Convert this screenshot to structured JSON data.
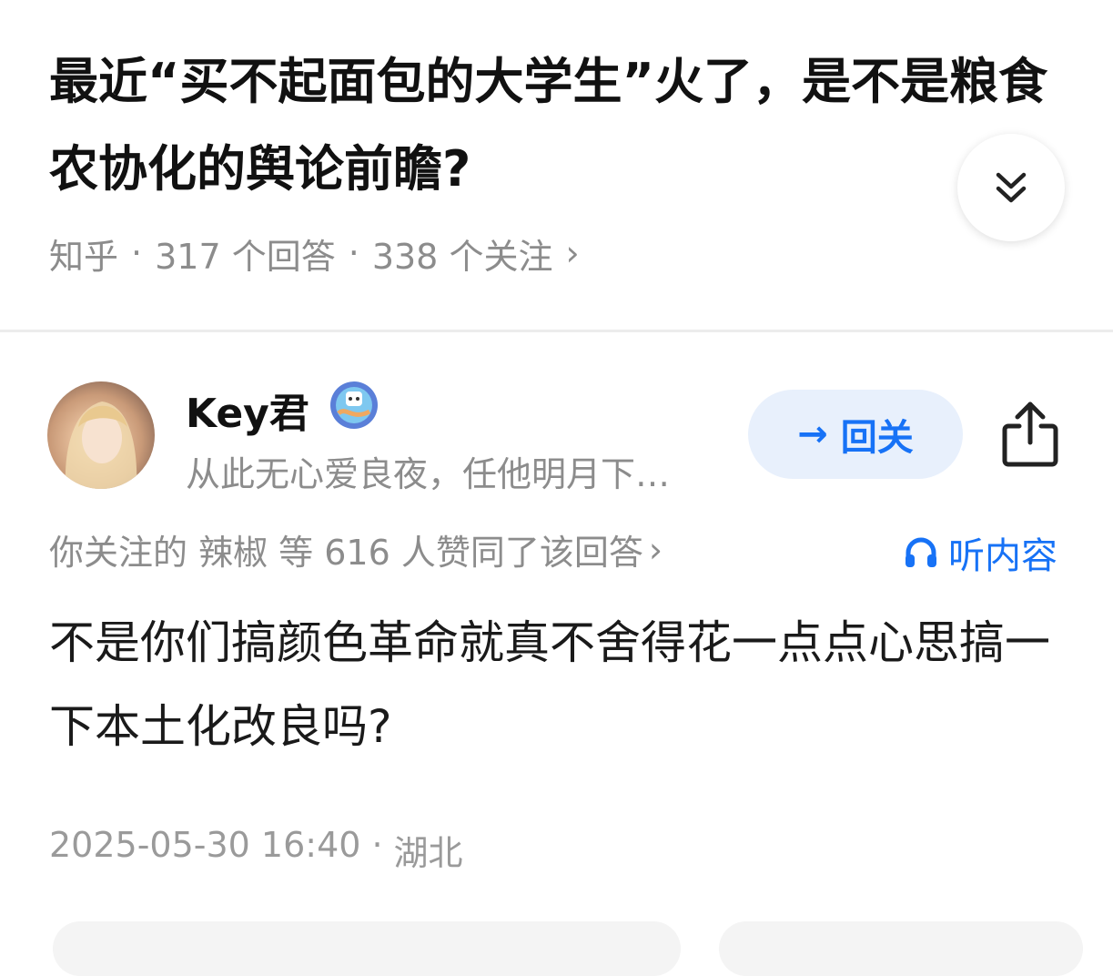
{
  "question": {
    "title": "最近“买不起面包的大学生”火了，是不是粮食农协化的舆论前瞻?",
    "source": "知乎",
    "answers": "317 个回答",
    "followers": "338 个关注",
    "chevron": "›"
  },
  "author": {
    "name": "Key君",
    "bio": "从此无心爱良夜，任他明月下…",
    "follow_label": "回关",
    "follow_arrow": "→"
  },
  "answer": {
    "likes_text": "你关注的 辣椒 等 616 人赞同了该回答",
    "likes_chevron": "›",
    "listen_label": "听内容",
    "body": "不是你们搞颜色革命就真不舍得花一点点心思搞一下本土化改良吗?",
    "date": "2025-05-30 16:40",
    "location": "湖北"
  },
  "colors": {
    "accent": "#1772f6",
    "muted": "#8c8c8c",
    "follow_bg": "#e8f0fc"
  },
  "icons": [
    "double-chevron-down-icon",
    "share-icon",
    "headphones-icon",
    "badge-icon"
  ]
}
